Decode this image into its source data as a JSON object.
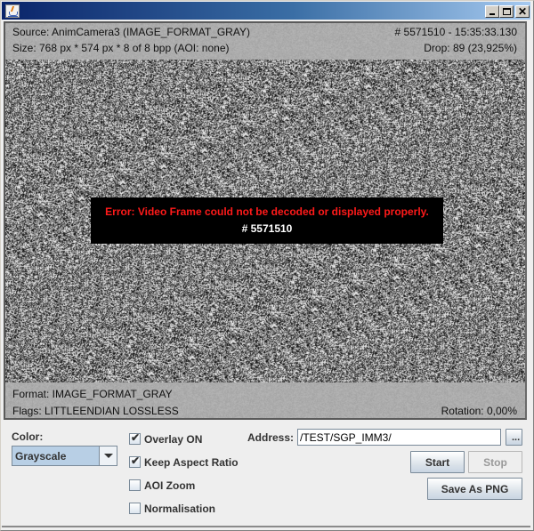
{
  "window": {
    "title": "",
    "controls": {
      "minimize": "_",
      "maximize": "□",
      "close": "✕"
    },
    "icon": "java-cup-icon"
  },
  "overlay": {
    "source": "Source: AnimCamera3 (IMAGE_FORMAT_GRAY)",
    "size": "Size: 768 px * 574 px * 8 of 8 bpp   (AOI: none)",
    "frame_time": "# 5571510 - 15:35:33.130",
    "drop": "Drop: 89 (23,925%)",
    "format": "Format: IMAGE_FORMAT_GRAY",
    "flags": "Flags: LITTLEENDIAN LOSSLESS",
    "rotation": "Rotation: 0,00%"
  },
  "error": {
    "message": "Error: Video Frame could not be decoded or displayed properly.",
    "frame_number": "# 5571510",
    "color": "#ff1a1a"
  },
  "controls": {
    "color_label": "Color:",
    "color_selected": "Grayscale",
    "checkboxes": [
      {
        "label": "Overlay ON",
        "checked": true
      },
      {
        "label": "Keep Aspect Ratio",
        "checked": true
      },
      {
        "label": "AOI Zoom",
        "checked": false
      },
      {
        "label": "Normalisation",
        "checked": false
      }
    ],
    "address_label": "Address:",
    "address_value": "/TEST/SGP_IMM3/",
    "browse_label": "...",
    "start_label": "Start",
    "stop_label": "Stop",
    "stop_enabled": false,
    "save_label": "Save As PNG"
  }
}
